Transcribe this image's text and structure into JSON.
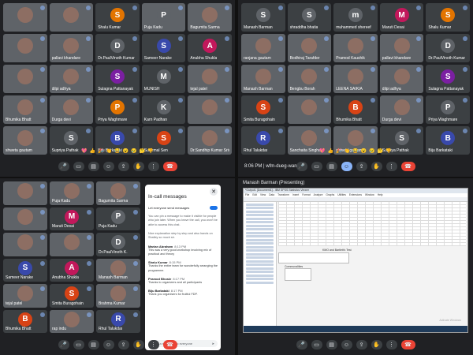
{
  "top_left": {
    "tiles": [
      {
        "name": "",
        "type": "video"
      },
      {
        "name": "",
        "type": "video"
      },
      {
        "name": "Shalu Kumar",
        "initial": "S",
        "color": "#e37400"
      },
      {
        "name": "Puja Kadu",
        "initial": "P",
        "color": "#5f6368",
        "type": "video"
      },
      {
        "name": "Bagumita Sarma",
        "type": "video"
      },
      {
        "name": "",
        "type": "video"
      },
      {
        "name": "pallavi khandare",
        "type": "video"
      },
      {
        "name": "Dr.PaulVinoth Kumar",
        "initial": "D",
        "color": "#5f6368"
      },
      {
        "name": "Sameer Narake",
        "initial": "S",
        "color": "#3949ab"
      },
      {
        "name": "Anubha Shukla",
        "initial": "A",
        "color": "#c2185b"
      },
      {
        "name": "",
        "type": "video"
      },
      {
        "name": "dilpi adhya",
        "type": "video"
      },
      {
        "name": "Sulagna Pattanayak",
        "initial": "S",
        "color": "#7b1fa2"
      },
      {
        "name": "MUNISH",
        "initial": "M",
        "color": "#5f6368"
      },
      {
        "name": "tejal patel",
        "type": "video"
      },
      {
        "name": "Bhumika Bhatt",
        "type": "video"
      },
      {
        "name": "Durga devi",
        "type": "video"
      },
      {
        "name": "Priya Waghmare",
        "initial": "P",
        "color": "#e37400"
      },
      {
        "name": "Karn Padhan",
        "initial": "K",
        "color": "#5f6368"
      },
      {
        "name": "",
        "type": "video"
      },
      {
        "name": "shweta gautam",
        "type": "video"
      },
      {
        "name": "Supriya Pathak",
        "initial": "S",
        "color": "#5f6368"
      },
      {
        "name": "Biju Barkataki",
        "initial": "B",
        "color": "#3949ab"
      },
      {
        "name": "Sunirmal Sen",
        "initial": "S",
        "color": "#d84315"
      },
      {
        "name": "Dr.Sandhip Kumar Sriva",
        "type": "video"
      }
    ],
    "emojis": [
      "💖",
      "👍",
      "🎉",
      "👏",
      "😂",
      "😮",
      "😢",
      "🤔",
      "👎"
    ]
  },
  "top_right": {
    "tiles": [
      {
        "name": "Manash Barman",
        "initial": "S",
        "color": "#5f6368"
      },
      {
        "name": "shraddha bhatia",
        "initial": "S",
        "color": "#5f6368"
      },
      {
        "name": "muhammed shereef",
        "initial": "m",
        "color": "#5f6368"
      },
      {
        "name": "Maruti Desai",
        "initial": "M",
        "color": "#c2185b"
      },
      {
        "name": "Shalu Kumar",
        "initial": "S",
        "color": "#e37400"
      },
      {
        "name": "ranjana gautam",
        "type": "video"
      },
      {
        "name": "Bodhiraj Tarafder",
        "type": "video"
      },
      {
        "name": "Pramod Kaushik",
        "type": "video"
      },
      {
        "name": "pallavi khandare",
        "type": "video"
      },
      {
        "name": "Dr.PaulVinoth Kumar",
        "initial": "D",
        "color": "#5f6368"
      },
      {
        "name": "Manash Barman",
        "type": "video"
      },
      {
        "name": "Bengbu Borah",
        "type": "video"
      },
      {
        "name": "LEENA SAIKIA",
        "type": "video"
      },
      {
        "name": "dilpi adhya",
        "type": "video"
      },
      {
        "name": "Sulagna Pattanayak",
        "initial": "S",
        "color": "#7b1fa2"
      },
      {
        "name": "Smita Buragohain",
        "initial": "S",
        "color": "#d84315"
      },
      {
        "name": "",
        "type": "video"
      },
      {
        "name": "Bhumika Bhatt",
        "initial": "B",
        "color": "#d84315"
      },
      {
        "name": "Durga devi",
        "type": "video"
      },
      {
        "name": "Priya Waghmare",
        "initial": "P",
        "color": "#5f6368"
      },
      {
        "name": "Rhul Talukdar",
        "initial": "R",
        "color": "#3949ab"
      },
      {
        "name": "Sanchaita Singha",
        "type": "video"
      },
      {
        "name": "shweta gautam",
        "type": "video"
      },
      {
        "name": "Supriya Pathak",
        "initial": "S",
        "color": "#5f6368"
      },
      {
        "name": "Biju Barkataki",
        "initial": "B",
        "color": "#3949ab"
      }
    ],
    "meeting_time": "8:06 PM",
    "meeting_code": "wfm-dueg-wan"
  },
  "bottom_left": {
    "tiles": [
      {
        "name": "",
        "type": "video"
      },
      {
        "name": "Puja Kadu",
        "type": "video"
      },
      {
        "name": "Bagumita Sarma",
        "type": "video"
      },
      {
        "name": "",
        "type": "video"
      },
      {
        "name": "Maruti Desai",
        "initial": "M",
        "color": "#c2185b"
      },
      {
        "name": "Puja Kadu",
        "initial": "P",
        "color": "#5f6368"
      },
      {
        "name": "",
        "type": "video"
      },
      {
        "name": "",
        "type": "video"
      },
      {
        "name": "Dr.PaulVinoth K.",
        "initial": "D",
        "color": "#5f6368"
      },
      {
        "name": "Sameer Narake",
        "initial": "S",
        "color": "#3949ab"
      },
      {
        "name": "Anubha Shukla",
        "initial": "A",
        "color": "#c2185b"
      },
      {
        "name": "Manash Barman",
        "type": "video"
      },
      {
        "name": "tejal patel",
        "type": "video"
      },
      {
        "name": "Smita Buragohain",
        "initial": "S",
        "color": "#d84315"
      },
      {
        "name": "Brahma Kumar",
        "type": "video"
      },
      {
        "name": "Bhumika Bhatt",
        "initial": "B",
        "color": "#d84315"
      },
      {
        "name": "rap indu",
        "type": "video"
      },
      {
        "name": "Rhul Talukdar",
        "initial": "R",
        "color": "#3949ab"
      },
      {
        "name": "Sanchaita Singha",
        "type": "video"
      },
      {
        "name": "",
        "type": "video"
      },
      {
        "name": "",
        "type": "video"
      },
      {
        "name": "Sunirmal Sen",
        "initial": "S",
        "color": "#d84315"
      },
      {
        "name": "Manjari",
        "type": "video"
      },
      {
        "name": "",
        "type": "video"
      },
      {
        "name": "",
        "type": "video"
      }
    ],
    "chat": {
      "title": "In-call messages",
      "toggle_label": "Let everyone send messages",
      "note": "You can pin a message to make it visible for people who join later. When you leave the call, you won't be able to access this chat.",
      "intro": "Nice explanation step by step and also hands on Shalley so much sir.",
      "messages": [
        {
          "who": "Marian Abraham",
          "time": "8:13 PM",
          "text": "This was a very good workshop involving mix of practical and theory"
        },
        {
          "who": "Shalu Kumar",
          "time": "8:15 PM",
          "text": "Thanks the entire team for wonderfully arranging the programme."
        },
        {
          "who": "Pramod Bhosle",
          "time": "8:17 PM",
          "text": "Thanks to organizers and all participants"
        },
        {
          "who": "Biju Barkataki",
          "time": "8:17 PM",
          "text": "Thank you organisers for fruitful FDP."
        }
      ],
      "send_placeholder": "Send a message to everyone"
    }
  },
  "bottom_right": {
    "presenter": "Manash Barman (Presenting)",
    "window_title": "*Output1 [Document1] - IBM SPSS Statistics Viewer",
    "menu": [
      "File",
      "Edit",
      "View",
      "Data",
      "Transform",
      "Insert",
      "Format",
      "Analyze",
      "Graphs",
      "Utilities",
      "Extensions",
      "Window",
      "Help"
    ],
    "box_title": "KMO and Bartlett's Test",
    "communalities_title": "Communalities",
    "watermark": "Activate Windows"
  },
  "toolbar_icons": [
    "mic-icon",
    "camera-icon",
    "captions-icon",
    "emoji-icon",
    "present-icon",
    "raise-hand-icon",
    "more-icon",
    "end-call-icon"
  ]
}
